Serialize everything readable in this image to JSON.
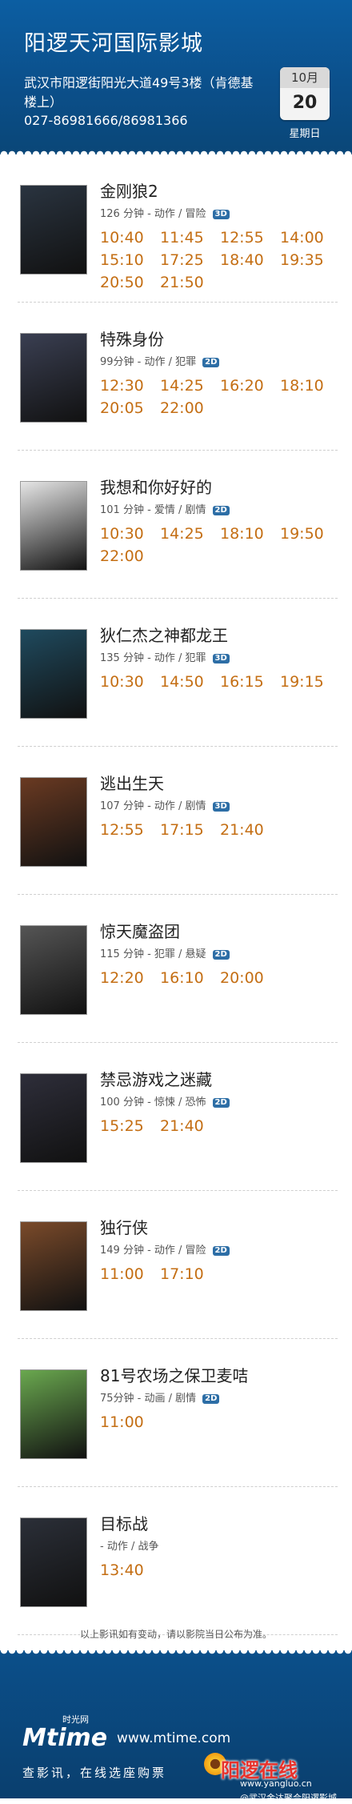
{
  "header": {
    "cinema_name": "阳逻天河国际影城",
    "address": "武汉市阳逻街阳光大道49号3楼（肯德基楼上）",
    "phone": "027-86981666/86981366",
    "date": {
      "month": "10月",
      "day": "20",
      "weekday": "星期日"
    }
  },
  "movies": [
    {
      "title": "金刚狼2",
      "meta": "126 分钟 - 动作 / 冒险",
      "format": "3D",
      "times": [
        "10:40",
        "11:45",
        "12:55",
        "14:00",
        "15:10",
        "17:25",
        "18:40",
        "19:35",
        "20:50",
        "21:50"
      ],
      "poster_color": "#2a3440"
    },
    {
      "title": "特殊身份",
      "meta": "99分钟 - 动作 / 犯罪",
      "format": "2D",
      "times": [
        "12:30",
        "14:25",
        "16:20",
        "18:10",
        "20:05",
        "22:00"
      ],
      "poster_color": "#3a3f52"
    },
    {
      "title": "我想和你好好的",
      "meta": "101 分钟 - 爱情 / 剧情",
      "format": "2D",
      "times": [
        "10:30",
        "14:25",
        "18:10",
        "19:50",
        "22:00"
      ],
      "poster_color": "#e6e6e6"
    },
    {
      "title": "狄仁杰之神都龙王",
      "meta": "135 分钟 - 动作 / 犯罪",
      "format": "3D",
      "times": [
        "10:30",
        "14:50",
        "16:15",
        "19:15"
      ],
      "poster_color": "#1f4a5e"
    },
    {
      "title": "逃出生天",
      "meta": "107 分钟 - 动作 / 剧情",
      "format": "3D",
      "times": [
        "12:55",
        "17:15",
        "21:40"
      ],
      "poster_color": "#6a3a22"
    },
    {
      "title": "惊天魔盗团",
      "meta": "115 分钟 - 犯罪 / 悬疑",
      "format": "2D",
      "times": [
        "12:20",
        "16:10",
        "20:00"
      ],
      "poster_color": "#555555"
    },
    {
      "title": "禁忌游戏之迷藏",
      "meta": "100 分钟 - 惊悚 / 恐怖",
      "format": "2D",
      "times": [
        "15:25",
        "21:40"
      ],
      "poster_color": "#2e2e3a"
    },
    {
      "title": "独行侠",
      "meta": "149 分钟 - 动作 / 冒险",
      "format": "2D",
      "times": [
        "11:00",
        "17:10"
      ],
      "poster_color": "#7a4a2a"
    },
    {
      "title": "81号农场之保卫麦咭",
      "meta": "75分钟 - 动画 / 剧情",
      "format": "2D",
      "times": [
        "11:00"
      ],
      "poster_color": "#6aa84f"
    },
    {
      "title": "目标战",
      "meta": "- 动作 / 战争",
      "format": "",
      "times": [
        "13:40"
      ],
      "poster_color": "#2b2f38"
    }
  ],
  "note": "以上影讯如有变动，请以影院当日公布为准。",
  "footer": {
    "logo": "Mtime",
    "logo_cn": "时光网",
    "url": "www.mtime.com",
    "slogan": "查影讯，在线选座购票",
    "watermark_site": "阳逻在线",
    "watermark_url": "www.yangluo.cn",
    "weibo": "@武汉金达聚合阳逻影城"
  }
}
